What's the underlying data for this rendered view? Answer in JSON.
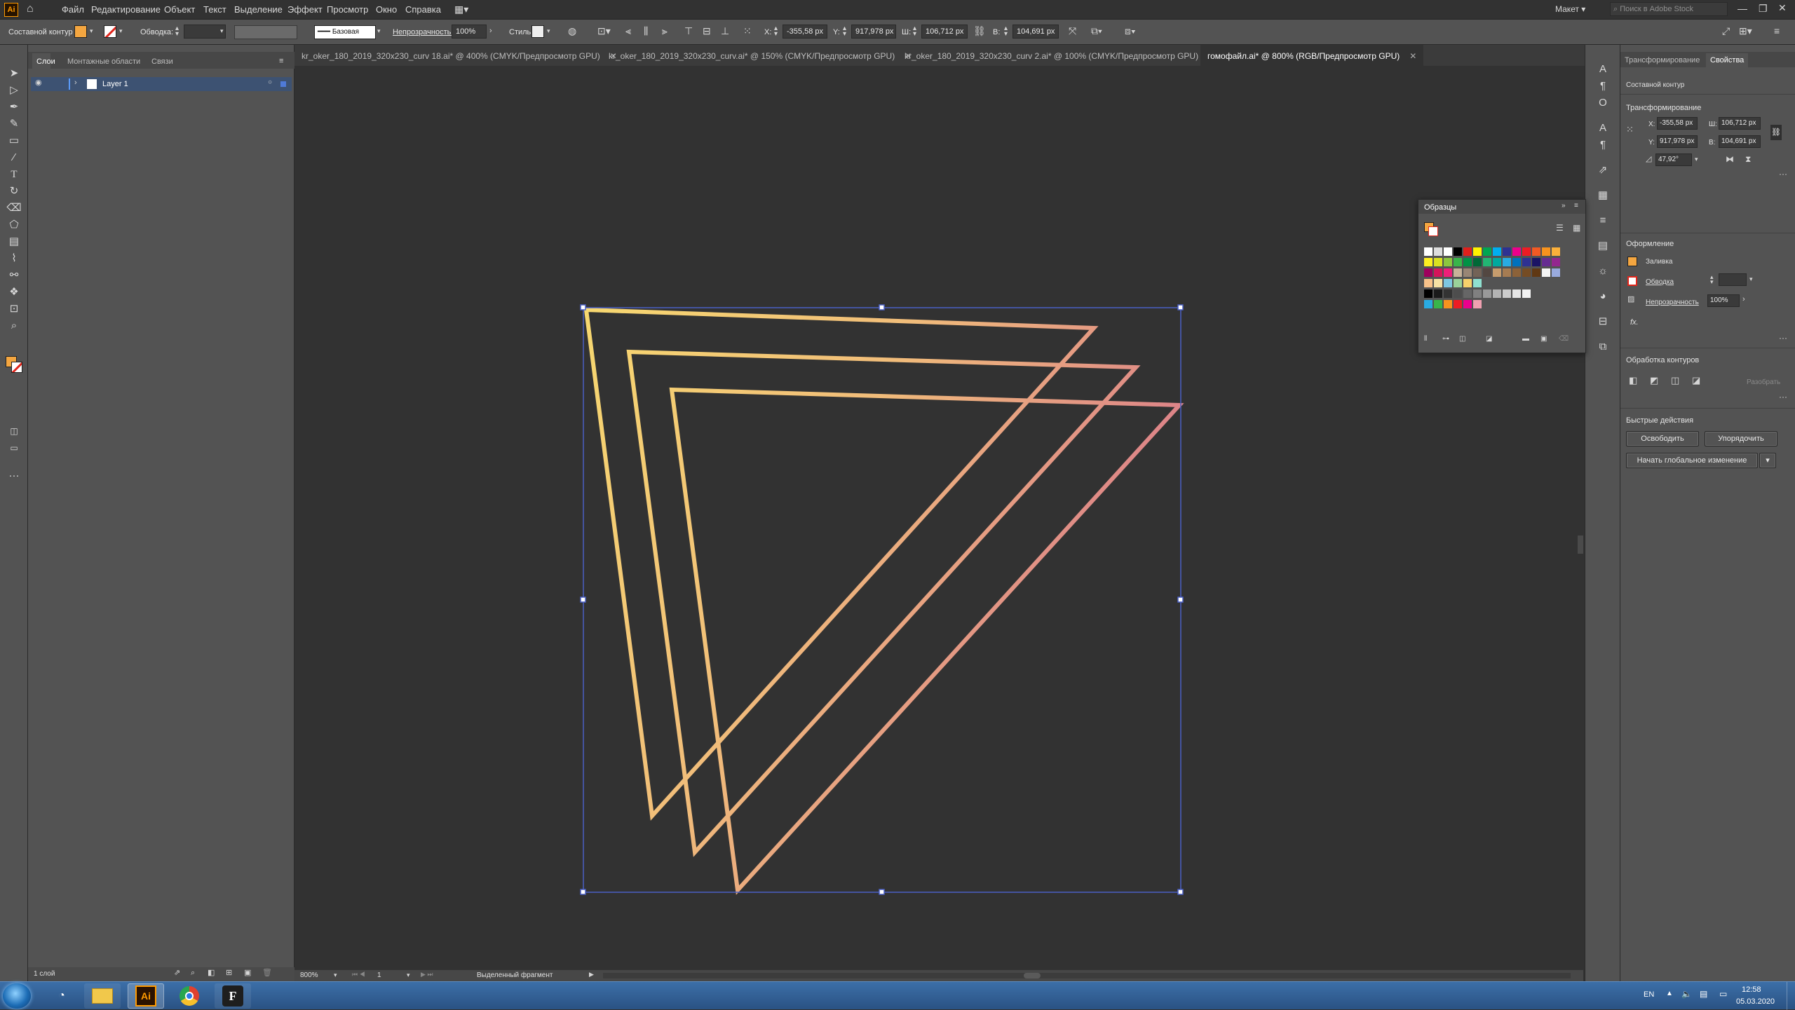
{
  "app": {
    "logo": "Ai"
  },
  "menu": [
    "Файл",
    "Редактирование",
    "Объект",
    "Текст",
    "Выделение",
    "Эффект",
    "Просмотр",
    "Окно",
    "Справка"
  ],
  "topright": {
    "workspace": "Макет",
    "search_placeholder": "Поиск в Adobe Stock"
  },
  "control": {
    "selection_type": "Составной контур",
    "stroke_label": "Обводка:",
    "brush_label": "Базовая",
    "opacity_label": "Непрозрачность:",
    "opacity": "100%",
    "style_label": "Стиль:",
    "x_label": "X:",
    "x": "-355,58 px",
    "y_label": "Y:",
    "y": "917,978 px",
    "w_label": "Ш:",
    "w": "106,712 px",
    "h_label": "В:",
    "h": "104,691 px"
  },
  "layers_panel": {
    "tabs": [
      "Слои",
      "Монтажные области",
      "Связи"
    ],
    "layer_name": "Layer 1",
    "footer": "1 слой"
  },
  "doc_tabs": [
    {
      "label": "kr_oker_180_2019_320x230_curv 18.ai* @ 400% (CMYK/Предпросмотр GPU)"
    },
    {
      "label": "kr_oker_180_2019_320x230_curv.ai* @ 150% (CMYK/Предпросмотр GPU)"
    },
    {
      "label": "kr_oker_180_2019_320x230_curv 2.ai* @ 100% (CMYK/Предпросмотр GPU)"
    },
    {
      "label": "гомофайл.ai* @ 800% (RGB/Предпросмотр GPU)"
    }
  ],
  "status": {
    "zoom": "800%",
    "page": "1",
    "mode": "Выделенный фрагмент"
  },
  "swatches_panel": {
    "title": "Образцы"
  },
  "properties": {
    "tabs": [
      "Трансформирование",
      "Свойства"
    ],
    "object_type": "Составной контур",
    "transform_title": "Трансформирование",
    "x_label": "X:",
    "x": "-355,58 px",
    "y_label": "Y:",
    "y": "917,978 px",
    "w_label": "Ш:",
    "w": "106,712 px",
    "h_label": "В:",
    "h": "104,691 px",
    "angle": "47,92°",
    "appearance_title": "Оформление",
    "fill_label": "Заливка",
    "stroke_label": "Обводка",
    "opacity_label": "Непрозрачность",
    "opacity": "100%",
    "fx": "fx.",
    "pathfinder_title": "Обработка контуров",
    "expand_btn": "Разобрать",
    "quick_title": "Быстрые действия",
    "release_btn": "Освободить",
    "arrange_btn": "Упорядочить",
    "global_edit_btn": "Начать глобальное изменение"
  },
  "taskbar": {
    "lang": "EN",
    "time": "12:58",
    "date": "05.03.2020"
  },
  "colors": {
    "fill": "#f4a640",
    "stroke_start": "#f6cf6a",
    "stroke_end": "#d9788a",
    "selection": "#4a5fc4"
  }
}
